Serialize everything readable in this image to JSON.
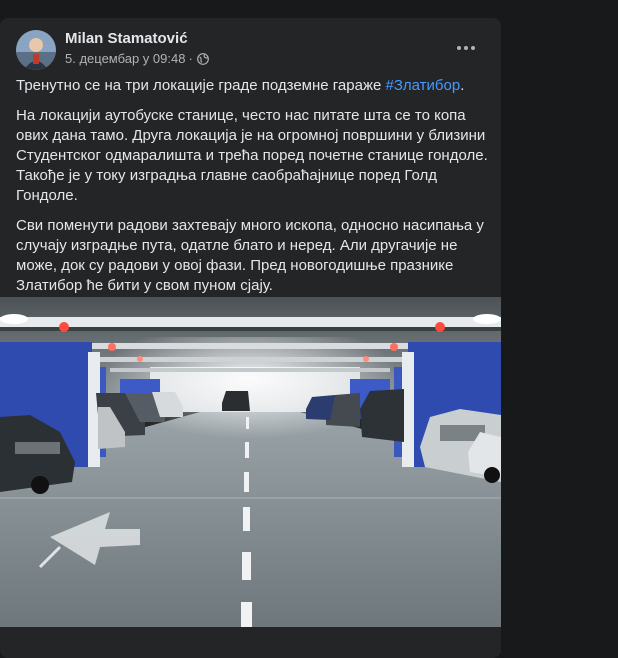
{
  "post": {
    "author": "Milan Stamatović",
    "date": "5. децембар у 09:48",
    "separator": "·",
    "visibility_icon": "globe-icon",
    "more_icon": "more-options-icon",
    "text_lead": "Тренутно се на три локације граде подземне гараже ",
    "hashtag": "#Златибор",
    "text_lead_end": ".",
    "paragraph_2": "На локацији аутобуске станице, често нас питате шта се то копа ових дана тамо. Друга локација је на огромној површини у близини Студентског одмаралишта и трећа поред почетне станице гондоле. Такође је у току изградња главне саобраћајнице поред Голд Гондоле.",
    "paragraph_3": "Сви поменути радови захтевају много ископа, односно насипања у случају изградње пута, одатле блато и неред. Али другачије не може, док су радови у овој фази. Пред новогодишње празнике Златибор ће бити у свом пуном сјају."
  },
  "colors": {
    "background": "#18191a",
    "card": "#242526",
    "text": "#e4e6eb",
    "secondary_text": "#b0b3b8",
    "link": "#4599ff"
  }
}
